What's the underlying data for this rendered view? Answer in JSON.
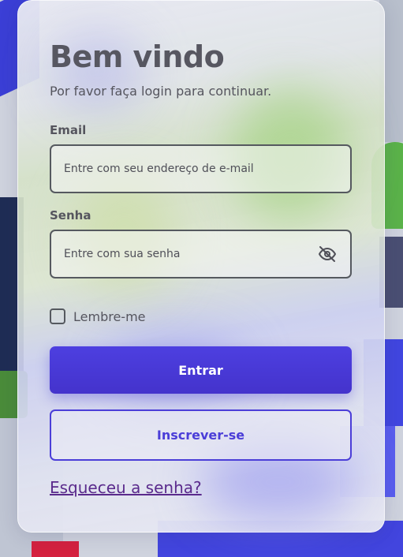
{
  "login": {
    "title": "Bem vindo",
    "subtitle": "Por favor faça login para continuar.",
    "email_label": "Email",
    "email_placeholder": "Entre com seu endereço de e-mail",
    "password_label": "Senha",
    "password_placeholder": "Entre com sua senha",
    "password_toggle_icon": "eye-off-icon",
    "remember_label": "Lembre-me",
    "remember_checked": false,
    "submit_label": "Entrar",
    "signup_label": "Inscrever-se",
    "forgot_label": "Esqueceu a senha?"
  },
  "colors": {
    "primary": "#4b3ed8",
    "text": "#55555e",
    "link": "#5a2a8c"
  }
}
